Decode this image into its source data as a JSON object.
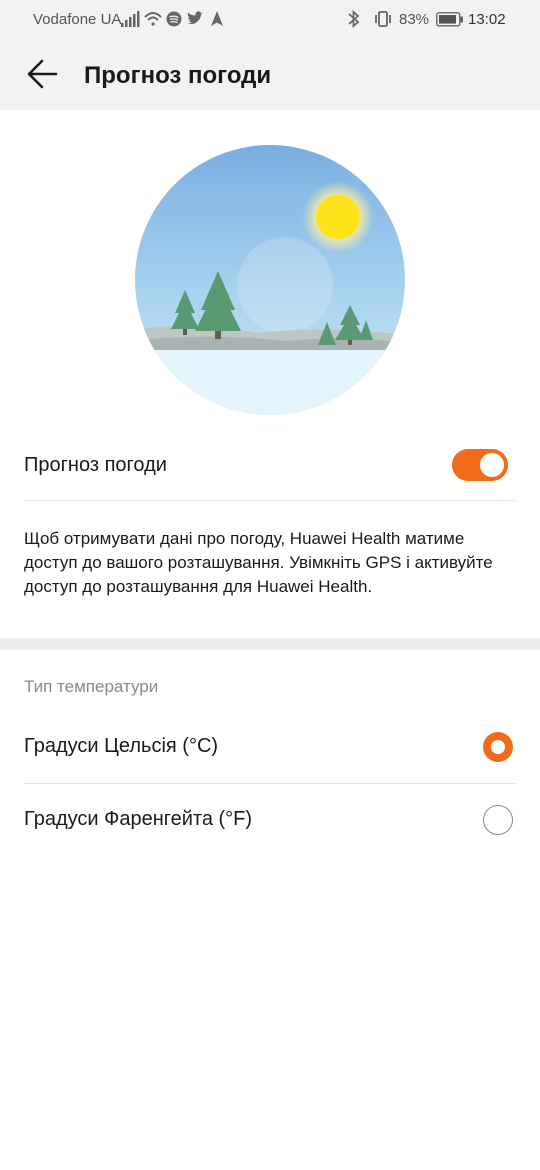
{
  "status_bar": {
    "carrier": "Vodafone UA",
    "battery_percent": "83%",
    "time": "13:02",
    "icons_left": [
      "signal-icon",
      "wifi-icon",
      "spotify-icon",
      "twitter-icon",
      "navigation-icon"
    ],
    "icons_right": [
      "bluetooth-icon",
      "vibrate-icon",
      "battery-icon"
    ]
  },
  "toolbar": {
    "title": "Прогноз погоди",
    "back_icon": "back-arrow-icon"
  },
  "weather_toggle": {
    "label": "Прогноз погоди",
    "enabled": true
  },
  "description": "Щоб отримувати дані про погоду, Huawei Health матиме доступ до вашого розташування. Увімкніть GPS і активуйте доступ до розташування для Huawei Health.",
  "temperature": {
    "section_title": "Тип температури",
    "options": [
      {
        "label": "Градуси Цельсія (°C)",
        "selected": true
      },
      {
        "label": "Градуси Фаренгейта (°F)",
        "selected": false
      }
    ]
  },
  "colors": {
    "accent": "#f26a1b",
    "toolbar_bg": "#f2f2f2",
    "divider_band": "#ececec"
  }
}
